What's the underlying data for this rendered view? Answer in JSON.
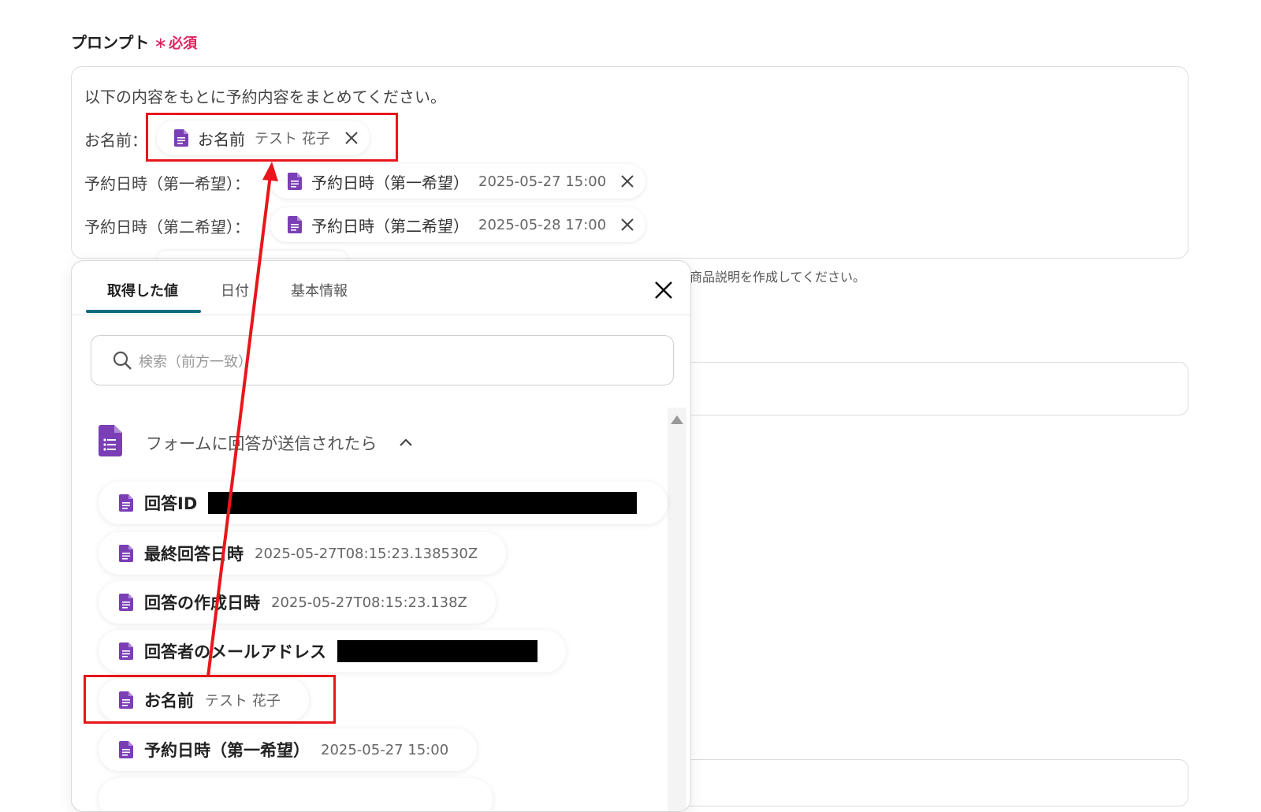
{
  "prompt": {
    "label": "プロンプト",
    "required_star": "∗",
    "required_text": "必須",
    "line1": "以下の内容をもとに予約内容をまとめてください。",
    "rows": [
      {
        "prefix": "お名前：",
        "chip_name": "お名前",
        "chip_value": "テスト 花子"
      },
      {
        "prefix": "予約日時（第一希望）：",
        "chip_name": "予約日時（第一希望）",
        "chip_value": "2025-05-27 15:00"
      },
      {
        "prefix": "予約日時（第二希望）：",
        "chip_name": "予約日時（第二希望）",
        "chip_value": "2025-05-28 17:00"
      }
    ]
  },
  "helper_text": "商品説明を作成してください。",
  "panel": {
    "tabs": [
      "取得した値",
      "日付",
      "基本情報"
    ],
    "search_placeholder": "検索（前方一致）",
    "group_title": "フォームに回答が送信されたら",
    "items": [
      {
        "label": "回答ID",
        "value": ""
      },
      {
        "label": "最終回答日時",
        "value": "2025-05-27T08:15:23.138530Z"
      },
      {
        "label": "回答の作成日時",
        "value": "2025-05-27T08:15:23.138Z"
      },
      {
        "label": "回答者のメールアドレス",
        "value": ""
      },
      {
        "label": "お名前",
        "value": "テスト 花子"
      },
      {
        "label": "予約日時（第一希望）",
        "value": "2025-05-27 15:00"
      }
    ]
  },
  "colors": {
    "accent": "#0e6b7c",
    "required": "#e0245e",
    "annotation": "#e8161a",
    "doc_icon": "#7b3fb5"
  },
  "icons": {
    "chip": "google-forms-doc-icon",
    "remove": "close-icon",
    "panel_close": "close-icon",
    "search": "search-icon",
    "group": "google-forms-icon",
    "collapse": "chevron-up-icon"
  }
}
